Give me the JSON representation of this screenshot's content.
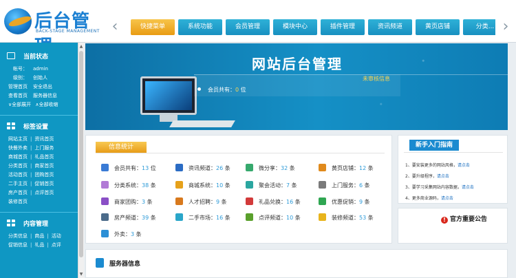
{
  "logo": {
    "title": "后台管理",
    "subtitle": "BACK-STAGE MANAGEMENT"
  },
  "nav": {
    "tabs": [
      "快捷菜单",
      "系统功能",
      "会员管理",
      "模块中心",
      "插件管理",
      "资讯频道",
      "黄页店铺",
      "分类..."
    ],
    "active_index": 0
  },
  "sidebar": {
    "current_status": {
      "title": "当前状态",
      "account_label": "帐号：",
      "account_value": "admin",
      "level_label": "级别：",
      "level_value": "创始人",
      "links": [
        [
          "管理首页",
          "安全退出"
        ],
        [
          "查看首页",
          "服务器信息"
        ]
      ],
      "expand_all": "全部展开",
      "collapse_all": "全部收缩"
    },
    "tag_settings": {
      "title": "标签设置",
      "rows": [
        [
          "网站主页",
          "资讯首页"
        ],
        [
          "快餐外卖",
          "上门服务"
        ],
        [
          "商城首页",
          "礼品首页"
        ],
        [
          "分类首页",
          "商家首页"
        ],
        [
          "活动首页",
          "团购首页"
        ],
        [
          "二手主页",
          "促销首页"
        ],
        [
          "房产首页",
          "点评首页"
        ],
        [
          "装修首页"
        ]
      ]
    },
    "content_mgmt": {
      "title": "内容管理",
      "rows": [
        [
          "分类信息",
          "商品",
          "活动"
        ],
        [
          "促销信息",
          "礼品",
          "点评"
        ]
      ]
    }
  },
  "banner": {
    "title": "网站后台管理",
    "unaudited": "未审核信息",
    "members_label": "会员共有：",
    "members_value": "0",
    "members_unit": "位"
  },
  "info": {
    "tag": "信息统计",
    "stats": [
      {
        "label": "会员共有：",
        "value": "13",
        "unit": "位",
        "color": "#3a7bd5"
      },
      {
        "label": "资讯频道：",
        "value": "26",
        "unit": "条",
        "color": "#2b6cc4"
      },
      {
        "label": "微分享：",
        "value": "32",
        "unit": "条",
        "color": "#36a96d"
      },
      {
        "label": "黄页店铺：",
        "value": "12",
        "unit": "条",
        "color": "#e08a1c"
      },
      {
        "label": "分类系统：",
        "value": "38",
        "unit": "条",
        "color": "#b17ad6"
      },
      {
        "label": "商城系统：",
        "value": "10",
        "unit": "条",
        "color": "#e6a11a"
      },
      {
        "label": "聚会活动：",
        "value": "7",
        "unit": "条",
        "color": "#2aa6a0"
      },
      {
        "label": "上门服务：",
        "value": "6",
        "unit": "条",
        "color": "#7a7a7a"
      },
      {
        "label": "商家团购：",
        "value": "3",
        "unit": "条",
        "color": "#8a4fc6"
      },
      {
        "label": "人才招聘：",
        "value": "9",
        "unit": "条",
        "color": "#d8791d"
      },
      {
        "label": "礼品兑换：",
        "value": "16",
        "unit": "条",
        "color": "#d23a3a"
      },
      {
        "label": "优惠促销：",
        "value": "9",
        "unit": "条",
        "color": "#2fa652"
      },
      {
        "label": "房产频道：",
        "value": "39",
        "unit": "条",
        "color": "#4b6b8a"
      },
      {
        "label": "二手市场：",
        "value": "16",
        "unit": "条",
        "color": "#2aa6c9"
      },
      {
        "label": "点评频道：",
        "value": "10",
        "unit": "条",
        "color": "#5aa02c"
      },
      {
        "label": "装修频道：",
        "value": "53",
        "unit": "条",
        "color": "#e8b41c"
      },
      {
        "label": "外卖：",
        "value": "3",
        "unit": "条",
        "color": "#2b8fd6"
      }
    ]
  },
  "guide": {
    "tag": "新手入门指南",
    "items": [
      {
        "text": "1、要安装更多的网站风格，",
        "link": "请点击"
      },
      {
        "text": "2、要升级程序，",
        "link": "请点击"
      },
      {
        "text": "3、要学习采集网站内容数据，",
        "link": "请点击"
      },
      {
        "text": "4、更多商业源码，",
        "link": "请点击"
      }
    ]
  },
  "notice": {
    "title": "官方重要公告",
    "icon_glyph": "!"
  },
  "server": {
    "title": "服务器信息"
  }
}
